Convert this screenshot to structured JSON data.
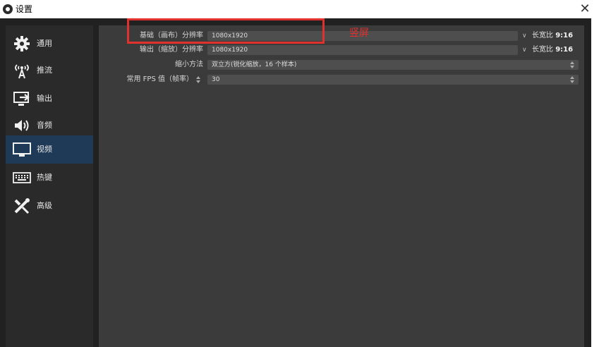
{
  "window": {
    "title": "设置",
    "close_glyph": "✕"
  },
  "sidebar": {
    "items": [
      {
        "label": "通用",
        "icon": "gear-icon"
      },
      {
        "label": "推流",
        "icon": "antenna-icon"
      },
      {
        "label": "输出",
        "icon": "output-icon"
      },
      {
        "label": "音频",
        "icon": "speaker-icon"
      },
      {
        "label": "视频",
        "icon": "monitor-icon",
        "active": true
      },
      {
        "label": "热键",
        "icon": "keyboard-icon"
      },
      {
        "label": "高级",
        "icon": "tools-icon"
      }
    ]
  },
  "video": {
    "base_resolution": {
      "label": "基础（画布）分辨率",
      "value": "1080x1920",
      "aspect_prefix": "长宽比",
      "aspect_value": "9:16"
    },
    "output_resolution": {
      "label": "输出（缩放）分辨率",
      "value": "1080x1920",
      "aspect_prefix": "长宽比",
      "aspect_value": "9:16"
    },
    "downscale_filter": {
      "label": "缩小方法",
      "value": "双立方(锐化缩放，16 个样本)"
    },
    "fps": {
      "label": "常用 FPS 值（帧率）",
      "value": "30"
    }
  },
  "annotation": {
    "text": "竖屏",
    "color": "#e0312f"
  },
  "colors": {
    "active_item": "#1e3a57",
    "panel": "#3b3b3b",
    "sidebar": "#2a2a2a",
    "field": "#4e4e4e"
  }
}
